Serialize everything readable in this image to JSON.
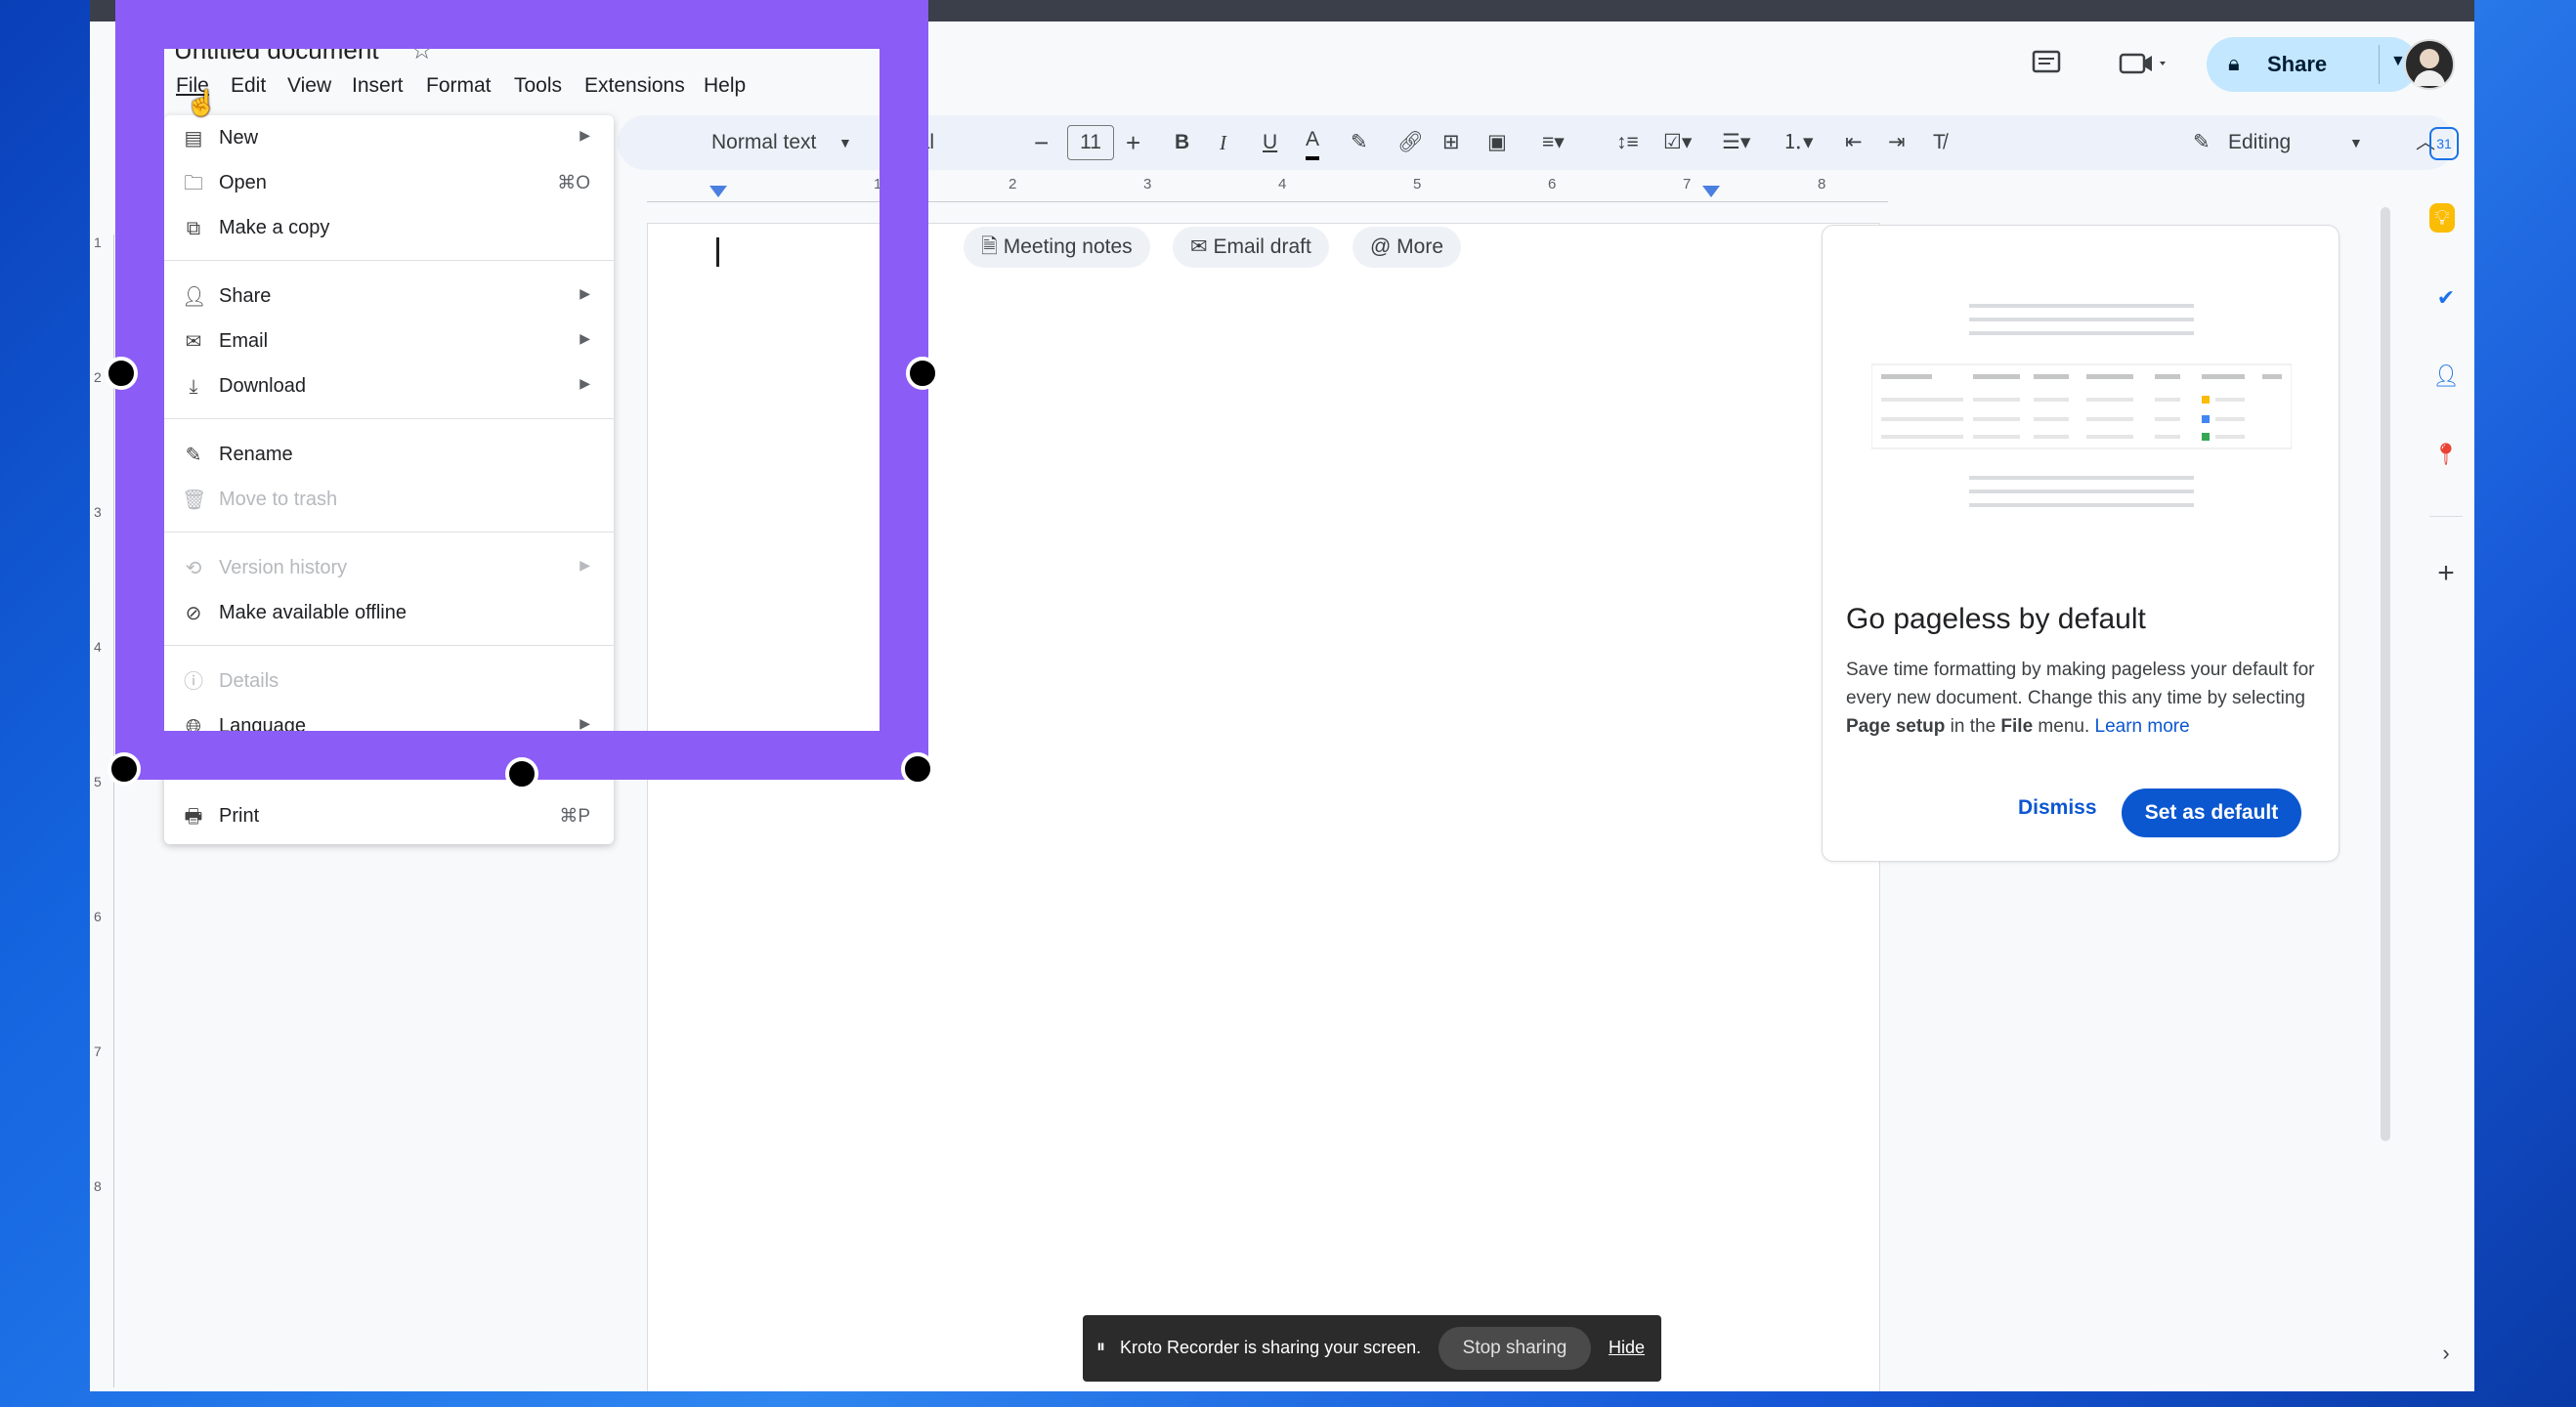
{
  "app": {
    "doc_title": "Untitled document"
  },
  "menubar": [
    "File",
    "Edit",
    "View",
    "Insert",
    "Format",
    "Tools",
    "Extensions",
    "Help"
  ],
  "header": {
    "share_label": "Share",
    "mode_label": "Editing"
  },
  "toolbar": {
    "style": "Normal text",
    "font": "Arial",
    "font_size": "11",
    "bold": "B",
    "italic": "I",
    "underline": "U",
    "text_color": "A"
  },
  "ruler": [
    "1",
    "2",
    "3",
    "4",
    "5",
    "6",
    "7",
    "8"
  ],
  "vruler": [
    "1",
    "2",
    "3",
    "4",
    "5",
    "6",
    "7",
    "8"
  ],
  "chips": {
    "meeting_notes": "Meeting notes",
    "email_draft": "Email draft",
    "more": "More"
  },
  "card": {
    "title": "Go pageless by default",
    "body_part1": "Save time formatting by making pageless your default for every new document. Change this any time by selecting ",
    "body_bold1": "Page setup",
    "body_part2": " in the ",
    "body_bold2": "File",
    "body_part3": " menu. ",
    "learn_more": "Learn more",
    "dismiss": "Dismiss",
    "set_default": "Set as default"
  },
  "file_menu": {
    "new": "New",
    "open": "Open",
    "open_shortcut": "⌘O",
    "make_copy": "Make a copy",
    "share": "Share",
    "email": "Email",
    "download": "Download",
    "rename": "Rename",
    "move_trash": "Move to trash",
    "version_history": "Version history",
    "offline": "Make available offline",
    "details": "Details",
    "language": "Language",
    "print": "Print",
    "print_shortcut": "⌘P"
  },
  "toast": {
    "message": "Kroto Recorder is sharing your screen.",
    "stop": "Stop sharing",
    "hide": "Hide"
  },
  "colors": {
    "accent": "#0b57d0",
    "selection": "#8b5cf6"
  }
}
